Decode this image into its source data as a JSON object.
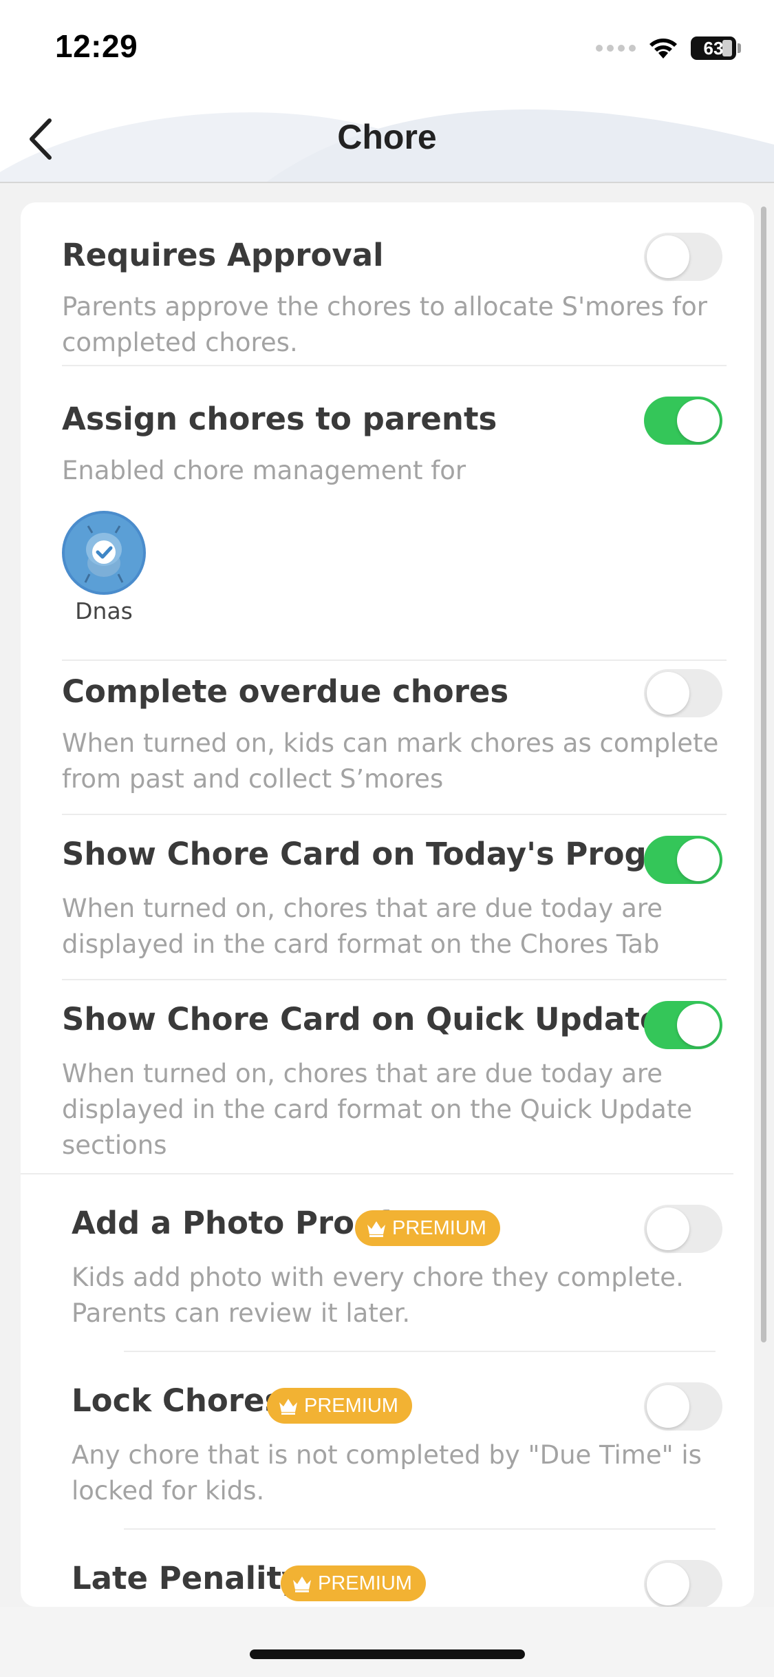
{
  "status_bar": {
    "time": "12:29",
    "battery": "63",
    "icons": [
      "signal-icon",
      "wifi-icon",
      "battery-icon"
    ]
  },
  "header": {
    "title": "Chore",
    "back_icon": "chevron-left-icon"
  },
  "settings": [
    {
      "title": "Requires Approval",
      "description": "Parents approve the chores to allocate S'mores for completed chores.",
      "enabled": false
    },
    {
      "title": "Assign chores to parents",
      "description": "Enabled chore management for",
      "enabled": true,
      "members": [
        {
          "name": "Dnas",
          "selected": true
        }
      ]
    },
    {
      "title": "Complete overdue chores",
      "description": "When turned on, kids can mark chores as complete from past and collect S’mores",
      "enabled": false
    },
    {
      "title": "Show Chore Card on Today's Progress",
      "description": "When turned on, chores that are due today are displayed in the card format on the Chores Tab",
      "enabled": true
    },
    {
      "title": "Show Chore Card on Quick Update",
      "description": "When turned on, chores that are due today are displayed in the card format on the Quick Update sections",
      "enabled": true
    }
  ],
  "premium_settings": [
    {
      "title": "Add a Photo Proof",
      "badge": "PREMIUM",
      "description": "Kids add photo with every chore they complete. Parents can review it later.",
      "enabled": false
    },
    {
      "title": "Lock Chores",
      "badge": "PREMIUM",
      "description": "Any chore that is not completed by \"Due Time\" is locked for kids.",
      "enabled": false
    },
    {
      "title": "Late Penality",
      "badge": "PREMIUM",
      "enabled": false
    }
  ],
  "colors": {
    "toggle_on": "#34c659",
    "toggle_off": "#ebebeb",
    "premium_badge": "#f2b233",
    "avatar": "#5b9fd6"
  }
}
